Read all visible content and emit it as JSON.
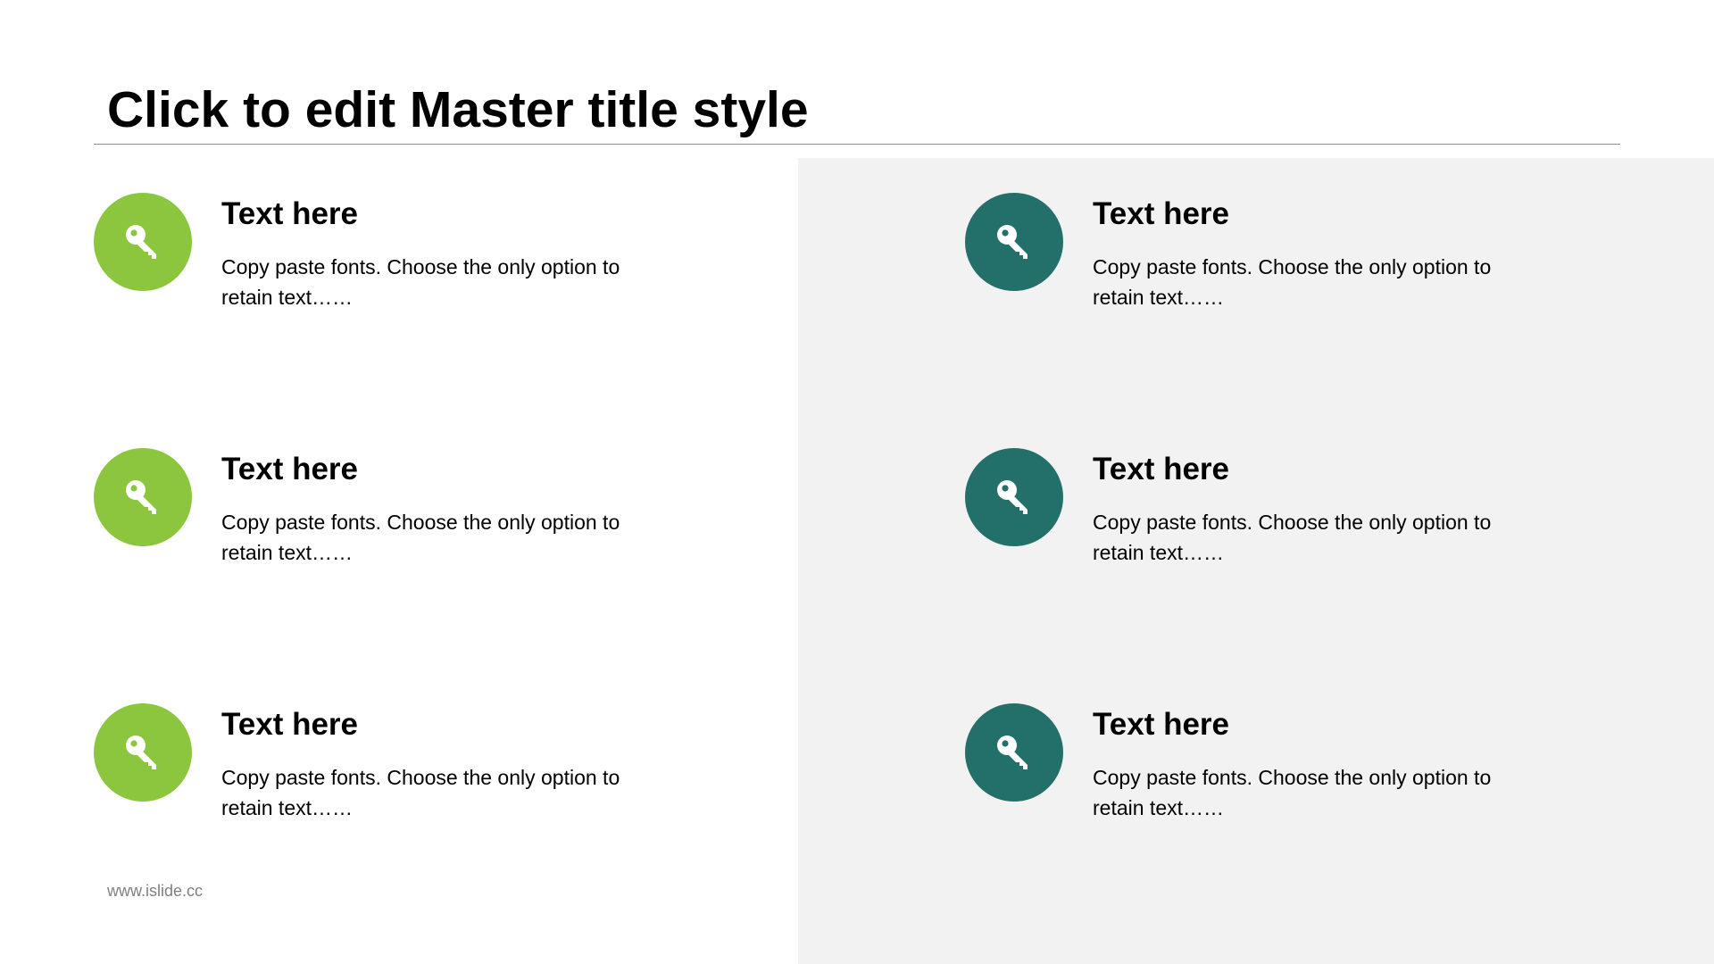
{
  "slide": {
    "title": "Click to edit Master title style",
    "footer": "www.islide.cc",
    "colors": {
      "accent_left": "#8cc63f",
      "accent_right": "#23706a",
      "panel_background": "#f2f2f2",
      "rule": "#8c8c8c"
    },
    "items": [
      {
        "heading": "Text here",
        "body": "Copy paste fonts. Choose the only option to retain text……",
        "icon": "key-icon"
      },
      {
        "heading": "Text here",
        "body": "Copy paste fonts. Choose the only option to retain text……",
        "icon": "key-icon"
      },
      {
        "heading": "Text here",
        "body": "Copy paste fonts. Choose the only option to retain text……",
        "icon": "key-icon"
      },
      {
        "heading": "Text here",
        "body": "Copy paste fonts. Choose the only option to retain text……",
        "icon": "key-icon"
      },
      {
        "heading": "Text here",
        "body": "Copy paste fonts. Choose the only option to retain text……",
        "icon": "key-icon"
      },
      {
        "heading": "Text here",
        "body": "Copy paste fonts. Choose the only option to retain text……",
        "icon": "key-icon"
      }
    ]
  }
}
